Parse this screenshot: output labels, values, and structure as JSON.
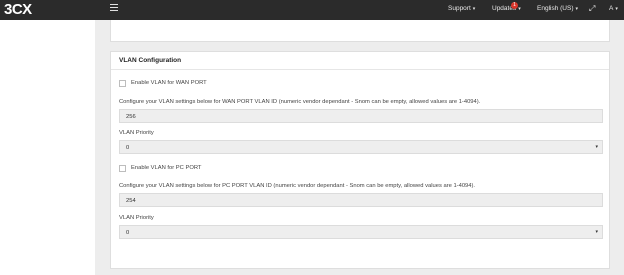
{
  "header": {
    "logo": "3CX",
    "support": "Support",
    "updates": "Updates",
    "updates_badge": "1",
    "language": "English (US)",
    "user": "A"
  },
  "vlan": {
    "title": "VLAN Configuration",
    "wan_enable_label": "Enable VLAN for WAN PORT",
    "wan_desc": "Configure your VLAN settings below for WAN PORT VLAN ID (numeric vendor dependant - Snom can be empty, allowed values are 1-4094).",
    "wan_id": "256",
    "wan_priority_label": "VLAN Priority",
    "wan_priority": "0",
    "pc_enable_label": "Enable VLAN for PC PORT",
    "pc_desc": "Configure your VLAN settings below for PC PORT VLAN ID (numeric vendor dependant - Snom can be empty, allowed values are 1-4094).",
    "pc_id": "254",
    "pc_priority_label": "VLAN Priority",
    "pc_priority": "0"
  }
}
